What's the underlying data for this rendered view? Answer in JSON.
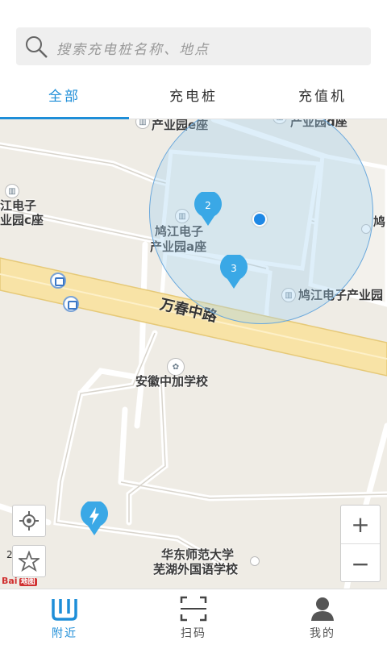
{
  "search": {
    "placeholder": "搜索充电桩名称、地点"
  },
  "tabs": [
    {
      "label": "全部",
      "active": true
    },
    {
      "label": "充电桩",
      "active": false
    },
    {
      "label": "充值机",
      "active": false
    }
  ],
  "map": {
    "road_name": "万春中路",
    "labels": {
      "park_e_top": "产业园e座",
      "park_d_top": "产业园d座",
      "left_line1": "江电子",
      "left_line2": "业园c座",
      "center_line1": "鸠江电子",
      "center_line2": "产业园a座",
      "right_park": "鸠江电子产业园",
      "right_edge": "鸠",
      "school": "安徽中加学校",
      "bottom_line1": "华东师范大学",
      "bottom_line2": "芜湖外国语学校"
    },
    "clusters": [
      {
        "count": "2"
      },
      {
        "count": "3"
      }
    ],
    "zoom_in": "+",
    "zoom_out": "−",
    "scale_text": "2",
    "brand": "Bai",
    "brand_suffix": "地图",
    "accent_color": "#1e8ed8",
    "marker_color": "#3aa8e6"
  },
  "bottom_nav": [
    {
      "label": "附近",
      "icon": "nearby-icon",
      "active": true
    },
    {
      "label": "扫码",
      "icon": "scan-icon",
      "active": false
    },
    {
      "label": "我的",
      "icon": "user-icon",
      "active": false
    }
  ]
}
